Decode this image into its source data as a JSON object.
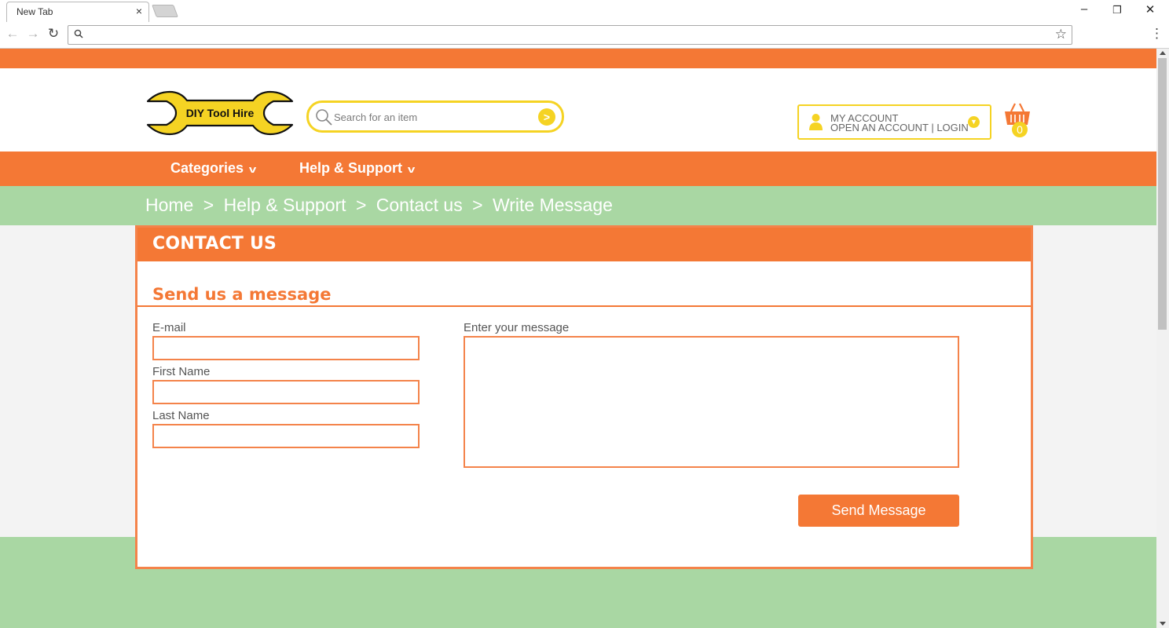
{
  "browser": {
    "tab_title": "New Tab",
    "tab_close": "×",
    "window_controls": [
      "–",
      "❐",
      "✕"
    ],
    "url": ""
  },
  "site": {
    "brand": "DIY Tool Hire",
    "colors": {
      "orange": "#f47835",
      "yellow": "#f5d323",
      "green": "#a9d7a3"
    },
    "search": {
      "placeholder": "Search for an item",
      "go_glyph": ">"
    },
    "account": {
      "line1": "MY ACCOUNT",
      "line2": "OPEN AN ACCOUNT | LOGIN"
    },
    "cart": {
      "count": "0"
    },
    "nav": [
      {
        "label": "Categories"
      },
      {
        "label": "Help & Support"
      }
    ],
    "breadcrumb": [
      "Home",
      "Help & Support",
      "Contact us",
      "Write Message"
    ],
    "breadcrumb_separator": ">"
  },
  "contact": {
    "title": "CONTACT US",
    "subtitle": "Send us a message",
    "fields": {
      "email": {
        "label": "E-mail",
        "value": ""
      },
      "first_name": {
        "label": "First Name",
        "value": ""
      },
      "last_name": {
        "label": "Last Name",
        "value": ""
      },
      "message": {
        "label": "Enter your message",
        "value": ""
      }
    },
    "submit_label": "Send Message"
  }
}
